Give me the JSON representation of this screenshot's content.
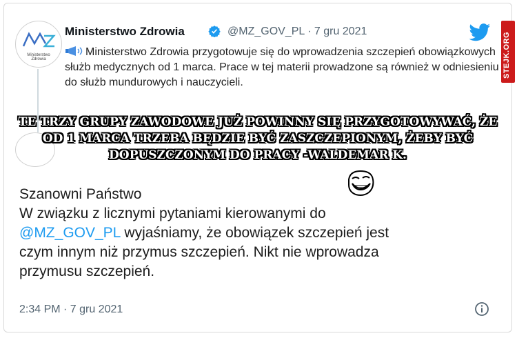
{
  "quoted_tweet": {
    "name": "Ministerstwo Zdrowia",
    "meta": "@MZ_GOV_PL · 7 gru 2021",
    "avatar_subtext": "Ministerstwo Zdrowia",
    "text": "Ministerstwo Zdrowia przygotowuje się do wprowadzenia szczepień obowiązkowych służb medycznych od 1 marca. Prace w tej materii prowadzone są również w odniesieniu do służb mundurowych i nauczycieli."
  },
  "main_tweet": {
    "line1": "Szanowni Państwo",
    "line2": "W związku z licznymi pytaniami kierowanymi do",
    "mention": "@MZ_GOV_PL",
    "line3_rest": " wyjaśniamy, że obowiązek szczepień jest",
    "line4": "czym innym niż przymus szczepień. Nikt nie wprowadza",
    "line5": "przymusu szczepień.",
    "timestamp": "2:34 PM · 7 gru 2021"
  },
  "meme_caption": "Te trzy grupy zawodowe już powinny się przygotowywać, że od 1 marca trzeba będzie być zaszczepionym, żeby być dopuszczonym do pracy -Waldemar K.",
  "watermark": "STEJK.ORG",
  "icons": {
    "twitter": "twitter-bird-icon",
    "verified": "verified-badge-icon",
    "megaphone": "megaphone-icon",
    "info": "info-icon",
    "troll": "troll-face-icon"
  },
  "colors": {
    "accent": "#1d9bf0",
    "watermark_bg": "#cc1b1b",
    "muted": "#536471"
  }
}
